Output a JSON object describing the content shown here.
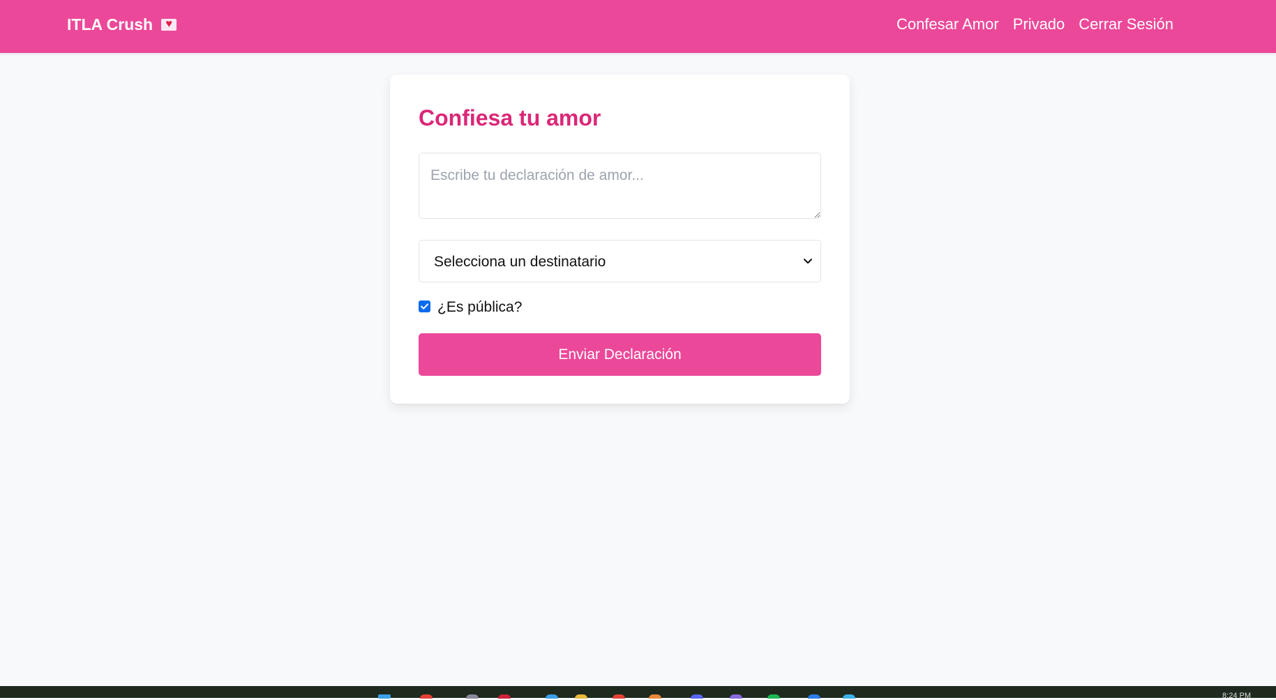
{
  "navbar": {
    "brand": "ITLA Crush",
    "brand_icon": "love-letter-icon",
    "links": [
      {
        "label": "Confesar Amor"
      },
      {
        "label": "Privado"
      },
      {
        "label": "Cerrar Sesión"
      }
    ]
  },
  "form": {
    "title": "Confiesa tu amor",
    "message_placeholder": "Escribe tu declaración de amor...",
    "message_value": "",
    "recipient_selected": "Selecciona un destinatario",
    "public_label": "¿Es pública?",
    "public_checked": true,
    "submit_label": "Enviar Declaración"
  },
  "taskbar": {
    "time": "8:24 PM"
  },
  "colors": {
    "primary": "#ec4899",
    "title": "#db2777",
    "background": "#f8f9fb",
    "checkbox": "#0b6bf0"
  }
}
